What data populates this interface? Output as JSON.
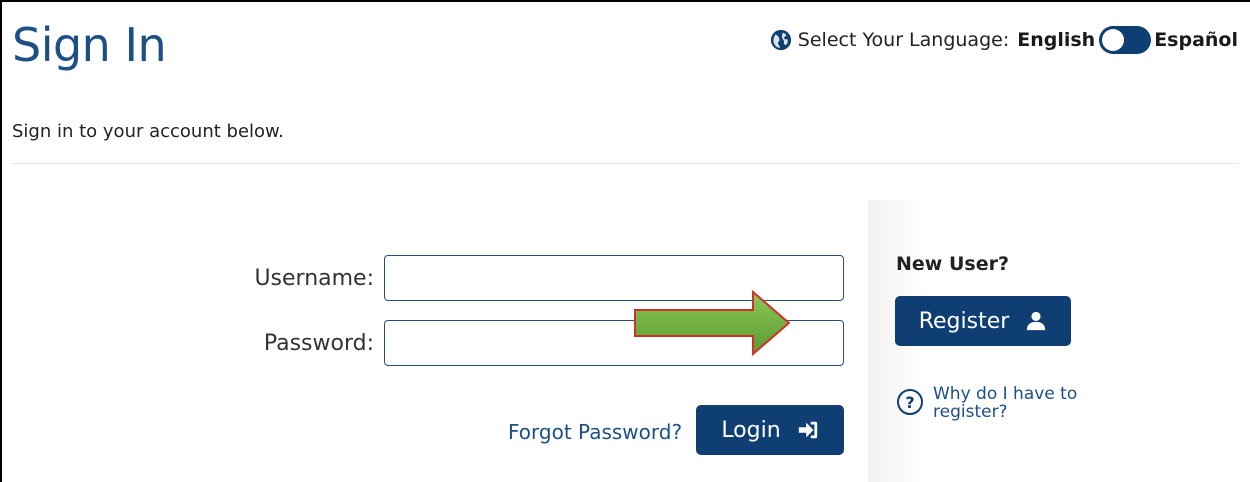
{
  "page": {
    "title": "Sign In",
    "subtitle": "Sign in to your account below."
  },
  "language": {
    "label": "Select Your Language:",
    "option_left": "English",
    "option_right": "Español",
    "selected": "English",
    "globe_icon": "globe-icon"
  },
  "form": {
    "username_label": "Username:",
    "username_value": "",
    "password_label": "Password:",
    "password_value": "",
    "forgot_label": "Forgot Password?",
    "login_label": "Login",
    "login_icon": "sign-in-icon"
  },
  "sidebar": {
    "new_user_label": "New User?",
    "register_label": "Register",
    "register_icon": "user-icon",
    "why_label": "Why do I have to register?",
    "help_icon": "question-circle-icon"
  },
  "annotation": {
    "arrow_color": "#6aab3a",
    "arrow_border": "#d0312d"
  },
  "colors": {
    "primary": "#0e3e72",
    "title": "#1b4f86"
  }
}
